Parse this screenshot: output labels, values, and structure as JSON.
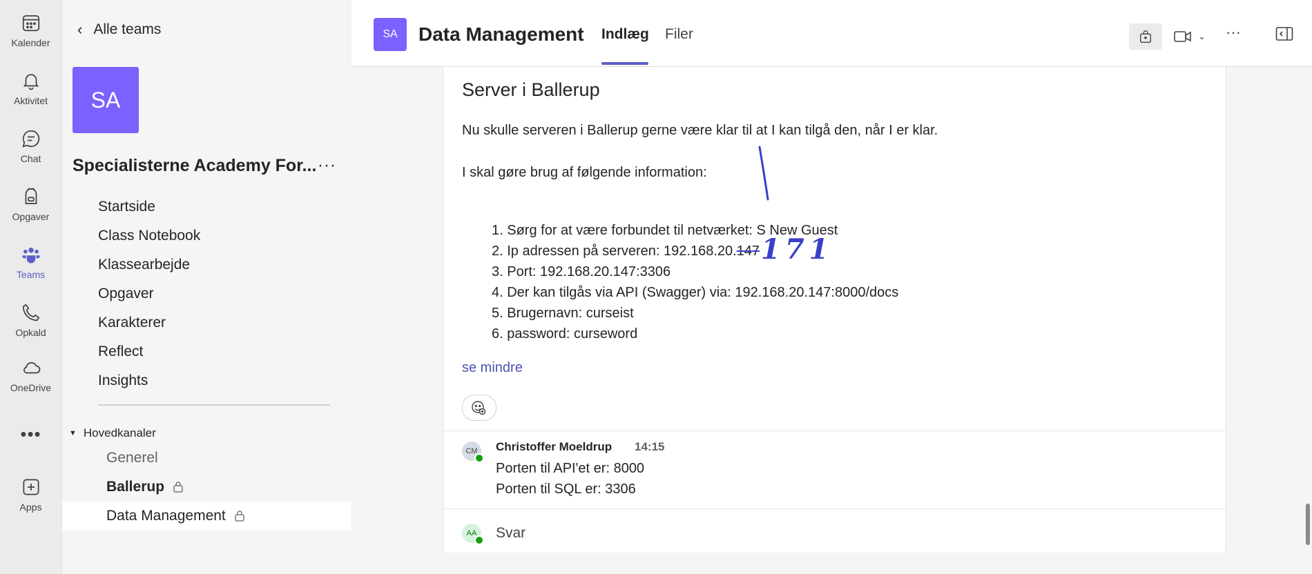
{
  "rail": {
    "items": [
      {
        "label": "Kalender",
        "icon": "calendar-icon"
      },
      {
        "label": "Aktivitet",
        "icon": "bell-icon"
      },
      {
        "label": "Chat",
        "icon": "chat-icon"
      },
      {
        "label": "Opgaver",
        "icon": "backpack-icon"
      },
      {
        "label": "Teams",
        "icon": "teams-icon"
      },
      {
        "label": "Opkald",
        "icon": "phone-icon"
      },
      {
        "label": "OneDrive",
        "icon": "cloud-icon"
      },
      {
        "label": "Apps",
        "icon": "apps-icon"
      }
    ]
  },
  "sidebar": {
    "back_label": "Alle teams",
    "team_initials": "SA",
    "team_name": "Specialisterne Academy For...",
    "nav": [
      "Startside",
      "Class Notebook",
      "Klassearbejde",
      "Opgaver",
      "Karakterer",
      "Reflect",
      "Insights"
    ],
    "channels_header": "Hovedkanaler",
    "channels": [
      {
        "label": "Generel"
      },
      {
        "label": "Ballerup"
      },
      {
        "label": "Data Management"
      }
    ]
  },
  "header": {
    "avatar": "SA",
    "title": "Data Management",
    "tabs": [
      "Indlæg",
      "Filer"
    ]
  },
  "post": {
    "title": "Server i Ballerup",
    "intro": "Nu skulle serveren i Ballerup gerne være klar til at I kan tilgå den, når I er klar.",
    "lead": "I skal gøre brug af følgende information:",
    "items": [
      "1. Sørg for at være forbundet til netværket: S New Guest",
      "2. Ip adressen på serveren: 192.168.20.",
      "3. Port: 192.168.20.147:3306",
      "4. Der kan tilgås via API (Swagger) via: 192.168.20.147:8000/docs",
      "5. Brugernavn: curseist",
      "6. password: curseword"
    ],
    "struck_value": "147",
    "handwritten_value": "171",
    "see_less": "se mindre"
  },
  "reply": {
    "initials": "CM",
    "author": "Christoffer Moeldrup",
    "time": "14:15",
    "lines": [
      "Porten til API'et er: 8000",
      "Porten til SQL er: 3306"
    ]
  },
  "compose": {
    "initials": "AA",
    "label": "Svar"
  },
  "colors": {
    "accent": "#5b5fc7",
    "team": "#7b61ff",
    "ink": "#3b3fc7"
  }
}
